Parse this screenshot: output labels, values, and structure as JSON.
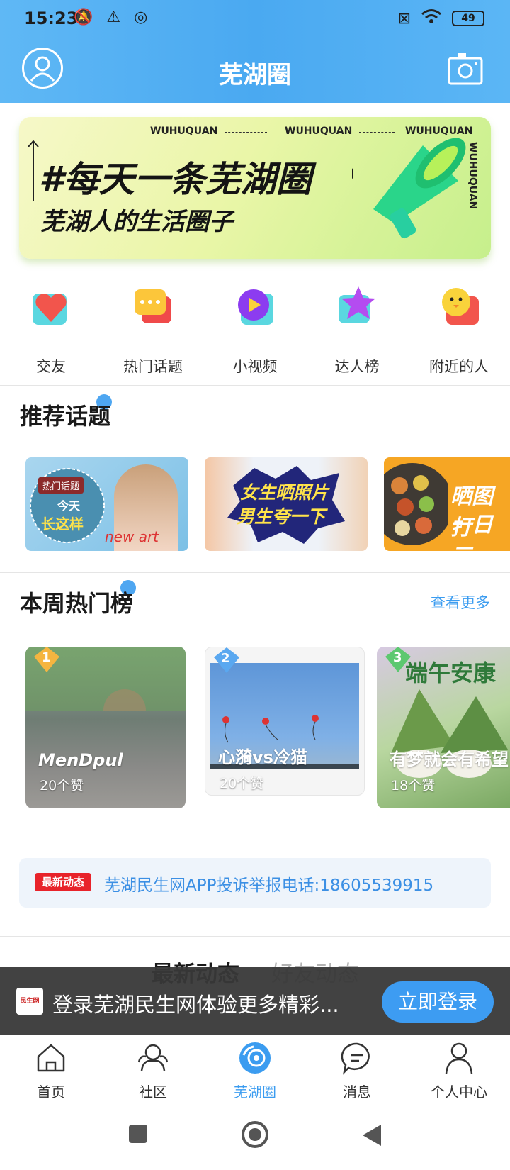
{
  "status": {
    "time": "15:23",
    "left_icons": "🔕 ⚠ ◎",
    "battery": "49"
  },
  "header": {
    "title": "芜湖圈",
    "avatar_icon": "user-icon",
    "camera_icon": "camera-icon"
  },
  "banner": {
    "tag": "WUHUQUAN",
    "headline": "#每天一条芜湖圈",
    "subline": "芜湖人的生活圈子",
    "side_text": "WUHUQUAN"
  },
  "quick_menu": [
    {
      "label": "交友",
      "icon": "heart-icon",
      "color": "#f2554c"
    },
    {
      "label": "热门话题",
      "icon": "chat-bubble-icon",
      "color": "#f04a4a"
    },
    {
      "label": "小视频",
      "icon": "play-icon",
      "color": "#8c3cf0"
    },
    {
      "label": "达人榜",
      "icon": "star-icon",
      "color": "#b44cf0"
    },
    {
      "label": "附近的人",
      "icon": "chick-icon",
      "color": "#f4c93a"
    }
  ],
  "recommended": {
    "title": "推荐话题",
    "cards": [
      {
        "badge": "热门话题",
        "line1": "今天",
        "line2": "长这样",
        "script": "new art"
      },
      {
        "line1": "女生晒照片",
        "line2": "男生夸一下"
      },
      {
        "line1": "晒图打",
        "line2": "一日三"
      }
    ]
  },
  "weekly": {
    "title": "本周热门榜",
    "more": "查看更多",
    "items": [
      {
        "rank": "1",
        "name": "MenDpul",
        "likes": "20个赞",
        "badge_color": "#f5b540"
      },
      {
        "rank": "2",
        "name": "心漪vs冷猫",
        "likes": "20个赞",
        "badge_color": "#5aa8f0"
      },
      {
        "rank": "3",
        "name": "有梦就会有希望",
        "likes": "18个赞",
        "badge_color": "#5cc870",
        "overlay": "端午安康"
      }
    ]
  },
  "ticker": {
    "badge": "最新动态",
    "text": "芜湖民生网APP投诉举报电话:18605539915"
  },
  "feed_tabs": [
    {
      "label": "最新动态",
      "active": true
    },
    {
      "label": "好友动态",
      "active": false
    }
  ],
  "login_bar": {
    "logo_text": "民生网",
    "text": "登录芜湖民生网体验更多精彩...",
    "button": "立即登录"
  },
  "bottom_nav": [
    {
      "label": "首页",
      "icon": "home-icon",
      "active": false
    },
    {
      "label": "社区",
      "icon": "community-icon",
      "active": false
    },
    {
      "label": "芜湖圈",
      "icon": "circle-icon",
      "active": true
    },
    {
      "label": "消息",
      "icon": "message-icon",
      "active": false
    },
    {
      "label": "个人中心",
      "icon": "profile-icon",
      "active": false
    }
  ]
}
